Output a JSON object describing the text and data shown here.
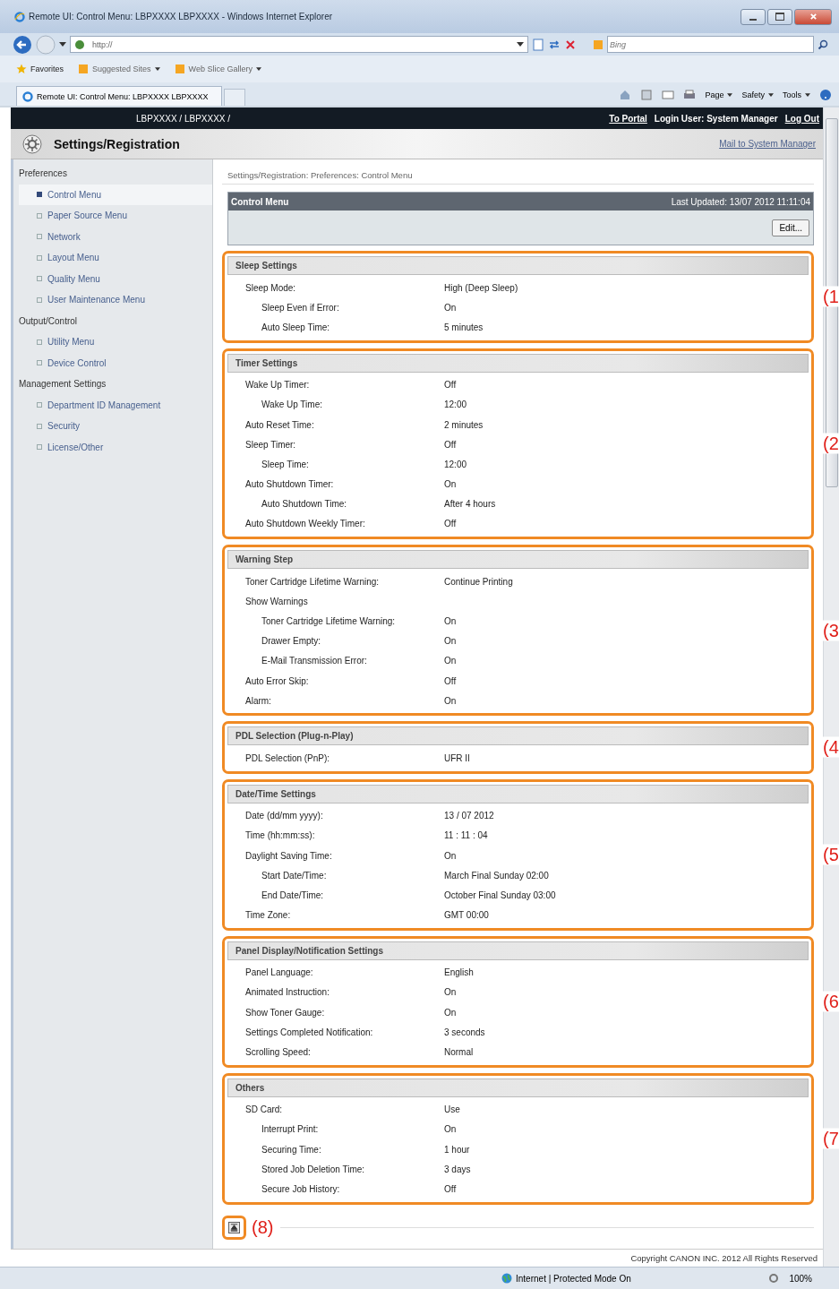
{
  "browser": {
    "title": "Remote UI: Control Menu: LBPXXXX LBPXXXX - Windows Internet Explorer",
    "address": "http://",
    "search_placeholder": "Bing",
    "favorites": [
      {
        "label": "Favorites",
        "kind": "star"
      },
      {
        "label": "Suggested Sites",
        "kind": "menu"
      },
      {
        "label": "Web Slice Gallery",
        "kind": "menu"
      }
    ],
    "tab": "Remote UI: Control Menu: LBPXXXX LBPXXXX",
    "commands": [
      "Page",
      "Safety",
      "Tools"
    ]
  },
  "header": {
    "model": "LBPXXXX / LBPXXXX /",
    "to_portal": "To Portal",
    "login_user": "Login User: System Manager",
    "log_out": "Log Out",
    "title": "Settings/Registration",
    "mail_link": "Mail to System Manager"
  },
  "sidebar": {
    "groups": [
      {
        "label": "Preferences",
        "items": [
          {
            "label": "Control Menu",
            "selected": true
          },
          {
            "label": "Paper Source Menu",
            "selected": false
          },
          {
            "label": "Network",
            "selected": false
          },
          {
            "label": "Layout Menu",
            "selected": false
          },
          {
            "label": "Quality Menu",
            "selected": false
          },
          {
            "label": "User Maintenance Menu",
            "selected": false
          }
        ]
      },
      {
        "label": "Output/Control",
        "items": [
          {
            "label": "Utility Menu",
            "selected": false
          },
          {
            "label": "Device Control",
            "selected": false
          }
        ]
      },
      {
        "label": "Management Settings",
        "items": [
          {
            "label": "Department ID Management",
            "selected": false
          },
          {
            "label": "Security",
            "selected": false
          },
          {
            "label": "License/Other",
            "selected": false
          }
        ]
      }
    ]
  },
  "breadcrumb": "Settings/Registration: Preferences: Control Menu",
  "panel": {
    "title": "Control Menu",
    "last_updated": "Last Updated: 13/07 2012 11:11:04",
    "edit_button": "Edit..."
  },
  "sections": [
    {
      "title": "Sleep Settings",
      "callout": "(1",
      "rows": [
        {
          "label": "Sleep Mode:",
          "value": "High (Deep Sleep)",
          "children": [
            {
              "label": "Sleep Even if Error:",
              "value": "On"
            },
            {
              "label": "Auto Sleep Time:",
              "value": "5 minutes"
            }
          ]
        }
      ]
    },
    {
      "title": "Timer Settings",
      "callout": "(2",
      "rows": [
        {
          "label": "Wake Up Timer:",
          "value": "Off",
          "children": [
            {
              "label": "Wake Up Time:",
              "value": "12:00"
            }
          ]
        },
        {
          "label": "Auto Reset Time:",
          "value": "2 minutes"
        },
        {
          "label": "Sleep Timer:",
          "value": "Off",
          "children": [
            {
              "label": "Sleep Time:",
              "value": "12:00"
            }
          ]
        },
        {
          "label": "Auto Shutdown Timer:",
          "value": "On",
          "children": [
            {
              "label": "Auto Shutdown Time:",
              "value": "After 4 hours"
            }
          ]
        },
        {
          "label": "Auto Shutdown Weekly Timer:",
          "value": "Off"
        }
      ]
    },
    {
      "title": "Warning Step",
      "callout": "(3",
      "rows": [
        {
          "label": "Toner Cartridge Lifetime Warning:",
          "value": "Continue Printing"
        },
        {
          "label": "Show Warnings",
          "children": [
            {
              "label": "Toner Cartridge Lifetime Warning:",
              "value": "On"
            },
            {
              "label": "Drawer Empty:",
              "value": "On"
            },
            {
              "label": "E-Mail Transmission Error:",
              "value": "On"
            }
          ]
        },
        {
          "label": "Auto Error Skip:",
          "value": "Off"
        },
        {
          "label": "Alarm:",
          "value": "On"
        }
      ]
    },
    {
      "title": "PDL Selection (Plug-n-Play)",
      "callout": "(4",
      "rows": [
        {
          "label": "PDL Selection (PnP):",
          "value": "UFR II"
        }
      ]
    },
    {
      "title": "Date/Time Settings",
      "callout": "(5",
      "rows": [
        {
          "label": "Date (dd/mm yyyy):",
          "value": "13 / 07 2012"
        },
        {
          "label": "Time (hh:mm:ss):",
          "value": "11 : 11 : 04"
        },
        {
          "label": "Daylight Saving Time:",
          "value": "On",
          "children": [
            {
              "label": "Start Date/Time:",
              "value": "March Final Sunday 02:00"
            },
            {
              "label": "End Date/Time:",
              "value": "October Final Sunday 03:00"
            }
          ]
        },
        {
          "label": "Time Zone:",
          "value": "GMT 00:00"
        }
      ]
    },
    {
      "title": "Panel Display/Notification Settings",
      "callout": "(6",
      "rows": [
        {
          "label": "Panel Language:",
          "value": "English"
        },
        {
          "label": "Animated Instruction:",
          "value": "On"
        },
        {
          "label": "Show Toner Gauge:",
          "value": "On"
        },
        {
          "label": "Settings Completed Notification:",
          "value": "3 seconds"
        },
        {
          "label": "Scrolling Speed:",
          "value": "Normal"
        }
      ]
    },
    {
      "title": "Others",
      "callout": "(7",
      "rows": [
        {
          "label": "SD Card:",
          "value": "Use",
          "children": [
            {
              "label": "Interrupt Print:",
              "value": "On"
            },
            {
              "label": "Securing Time:",
              "value": "1 hour"
            },
            {
              "label": "Stored Job Deletion Time:",
              "value": "3 days"
            },
            {
              "label": "Secure Job History:",
              "value": "Off"
            }
          ]
        }
      ]
    }
  ],
  "top_button": {
    "callout": "(8)"
  },
  "footer": {
    "copyright": "Copyright CANON INC. 2012 All Rights Reserved"
  },
  "status_bar": {
    "zone": "Internet | Protected Mode On",
    "zoom": "100%"
  }
}
